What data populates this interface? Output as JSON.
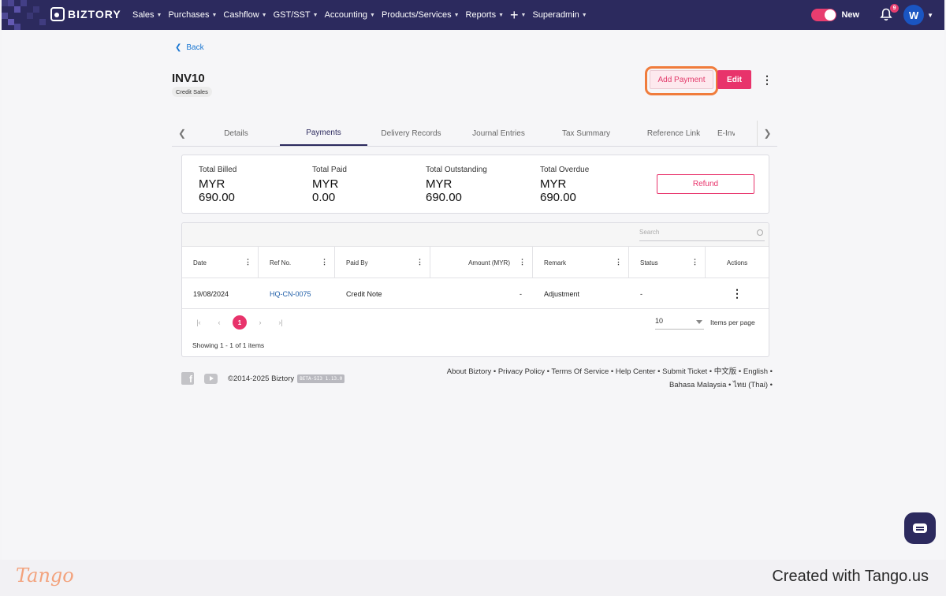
{
  "brand": {
    "name": "BIZTORY",
    "tango_logo": "Tango",
    "tango_credit": "Created with Tango.us"
  },
  "nav": {
    "items": [
      "Sales",
      "Purchases",
      "Cashflow",
      "GST/SST",
      "Accounting",
      "Products/Services",
      "Reports"
    ],
    "plus": "+",
    "superadmin": "Superadmin",
    "toggle_label": "New",
    "notification_count": "9",
    "avatar_initial": "W"
  },
  "page": {
    "back": "Back",
    "title": "INV10",
    "tag": "Credit Sales",
    "add_payment": "Add Payment",
    "edit": "Edit"
  },
  "tabs": [
    "Details",
    "Payments",
    "Delivery Records",
    "Journal Entries",
    "Tax Summary",
    "Reference Link",
    "E-Inv"
  ],
  "summary": {
    "items": [
      {
        "label": "Total Billed",
        "currency": "MYR",
        "amount": "690.00"
      },
      {
        "label": "Total Paid",
        "currency": "MYR",
        "amount": "0.00"
      },
      {
        "label": "Total Outstanding",
        "currency": "MYR",
        "amount": "690.00"
      },
      {
        "label": "Total Overdue",
        "currency": "MYR",
        "amount": "690.00"
      }
    ],
    "refund": "Refund"
  },
  "grid": {
    "search_placeholder": "Search",
    "columns": [
      "Date",
      "Ref No.",
      "Paid By",
      "Amount (MYR)",
      "Remark",
      "Status",
      "Actions"
    ],
    "rows": [
      {
        "date": "19/08/2024",
        "ref": "HQ-CN-0075",
        "paid_by": "Credit Note",
        "amount": "-",
        "remark": "Adjustment",
        "status": "-"
      }
    ],
    "current_page": "1",
    "per_page": "10",
    "per_page_label": "Items per page",
    "showing": "Showing 1 - 1 of 1 items"
  },
  "footer": {
    "copyright": "©2014-2025 Biztory",
    "beta": "BETA-SI3 1.13.0",
    "links_line1": "About Biztory • Privacy Policy • Terms Of Service • Help Center • Submit Ticket • 中文版 • English •",
    "links_line2": "Bahasa Malaysia • ไทย (Thai) •"
  },
  "colors": {
    "nav_bg": "#2c2a5e",
    "accent": "#e8336b",
    "highlight": "#f07c3c",
    "link": "#1f5ea8"
  }
}
